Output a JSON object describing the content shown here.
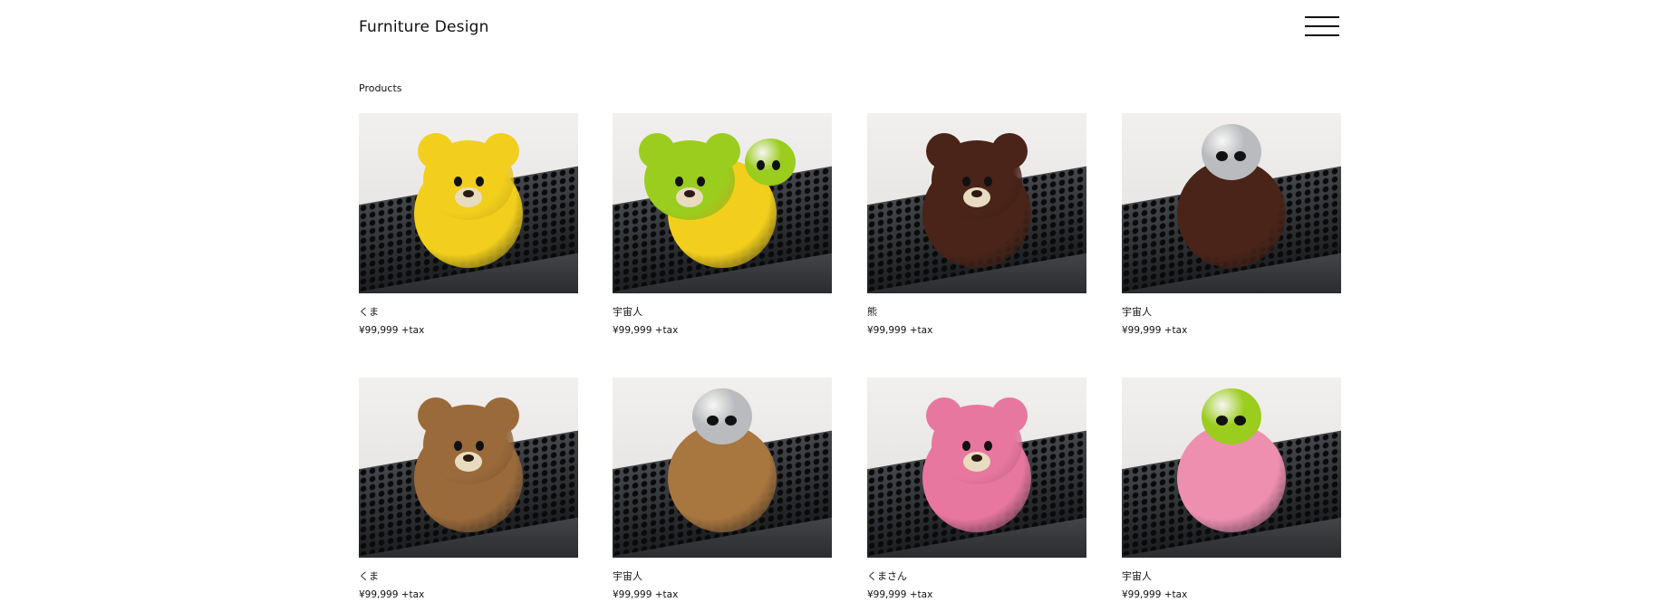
{
  "header": {
    "site_title": "Furniture Design",
    "menu_icon": "hamburger-menu-icon"
  },
  "section": {
    "title": "Products"
  },
  "products": [
    {
      "name": "くま",
      "price": "¥99,999 +tax",
      "toy": "bear",
      "color": "#f2cf1c",
      "head_color": "#f2cf1c"
    },
    {
      "name": "宇宙人",
      "price": "¥99,999 +tax",
      "toy": "bear-and-alien",
      "color": "#f2cf1c",
      "head_color": "#9acd1e"
    },
    {
      "name": "熊",
      "price": "¥99,999 +tax",
      "toy": "bear",
      "color": "#4a2418",
      "head_color": "#4a2418"
    },
    {
      "name": "宇宙人",
      "price": "¥99,999 +tax",
      "toy": "alien",
      "color": "#4a2418",
      "head_color": "#b9bbbe"
    },
    {
      "name": "くま",
      "price": "¥99,999 +tax",
      "toy": "bear",
      "color": "#9a6a3a",
      "head_color": "#9a6a3a"
    },
    {
      "name": "宇宙人",
      "price": "¥99,999 +tax",
      "toy": "alien",
      "color": "#a8763f",
      "head_color": "#b9bbbe"
    },
    {
      "name": "くまさん",
      "price": "¥99,999 +tax",
      "toy": "bear",
      "color": "#e8779f",
      "head_color": "#e8779f"
    },
    {
      "name": "宇宙人",
      "price": "¥99,999 +tax",
      "toy": "alien",
      "color": "#ee8fb0",
      "head_color": "#9acd1e"
    }
  ]
}
